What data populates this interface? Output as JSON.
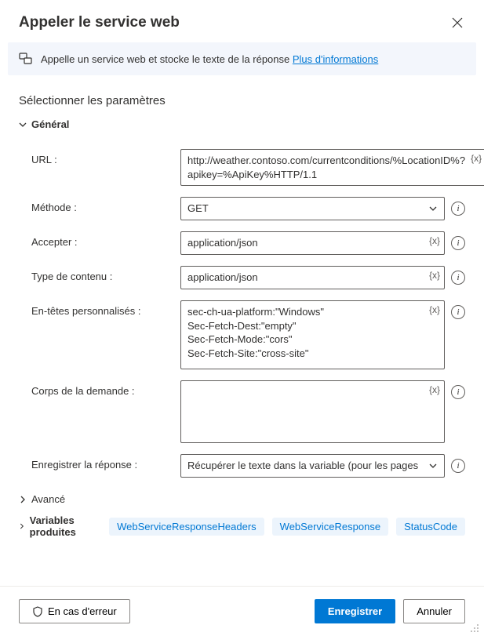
{
  "header": {
    "title": "Appeler le service web"
  },
  "banner": {
    "text": "Appelle un service web et stocke le texte de la réponse ",
    "link": "Plus d'informations"
  },
  "sectionTitle": "Sélectionner les paramètres",
  "accordions": {
    "general": "Général",
    "advanced": "Avancé",
    "variables": "Variables produites"
  },
  "fields": {
    "url": {
      "label": "URL :",
      "value": "http://weather.contoso.com/currentconditions/%LocationID%?apikey=%ApiKey%HTTP/1.1"
    },
    "method": {
      "label": "Méthode :",
      "value": "GET"
    },
    "accept": {
      "label": "Accepter :",
      "value": "application/json"
    },
    "contentType": {
      "label": "Type de contenu :",
      "value": "application/json"
    },
    "customHeaders": {
      "label": "En-têtes personnalisés :",
      "value": "sec-ch-ua-platform:\"Windows\"\nSec-Fetch-Dest:\"empty\"\nSec-Fetch-Mode:\"cors\"\nSec-Fetch-Site:\"cross-site\""
    },
    "requestBody": {
      "label": "Corps de la demande :",
      "value": ""
    },
    "saveResponse": {
      "label": "Enregistrer la réponse :",
      "value": "Récupérer le texte dans la variable (pour les pages"
    }
  },
  "varBadge": "{x}",
  "chips": [
    "WebServiceResponseHeaders",
    "WebServiceResponse",
    "StatusCode"
  ],
  "footer": {
    "onError": "En cas d'erreur",
    "save": "Enregistrer",
    "cancel": "Annuler"
  }
}
